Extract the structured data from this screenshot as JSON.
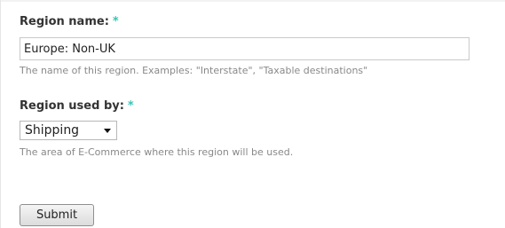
{
  "form": {
    "region_name": {
      "label": "Region name:",
      "required_marker": "*",
      "value": "Europe: Non-UK",
      "description": "The name of this region. Examples: \"Interstate\", \"Taxable destinations\""
    },
    "region_used_by": {
      "label": "Region used by:",
      "required_marker": "*",
      "selected": "Shipping",
      "description": "The area of E-Commerce where this region will be used."
    },
    "submit_label": "Submit"
  },
  "colors": {
    "required_marker": "#38c4b5",
    "label_text": "#333333",
    "description_text": "#898989"
  },
  "icons": {
    "select_arrow": "chevron-down-icon"
  }
}
